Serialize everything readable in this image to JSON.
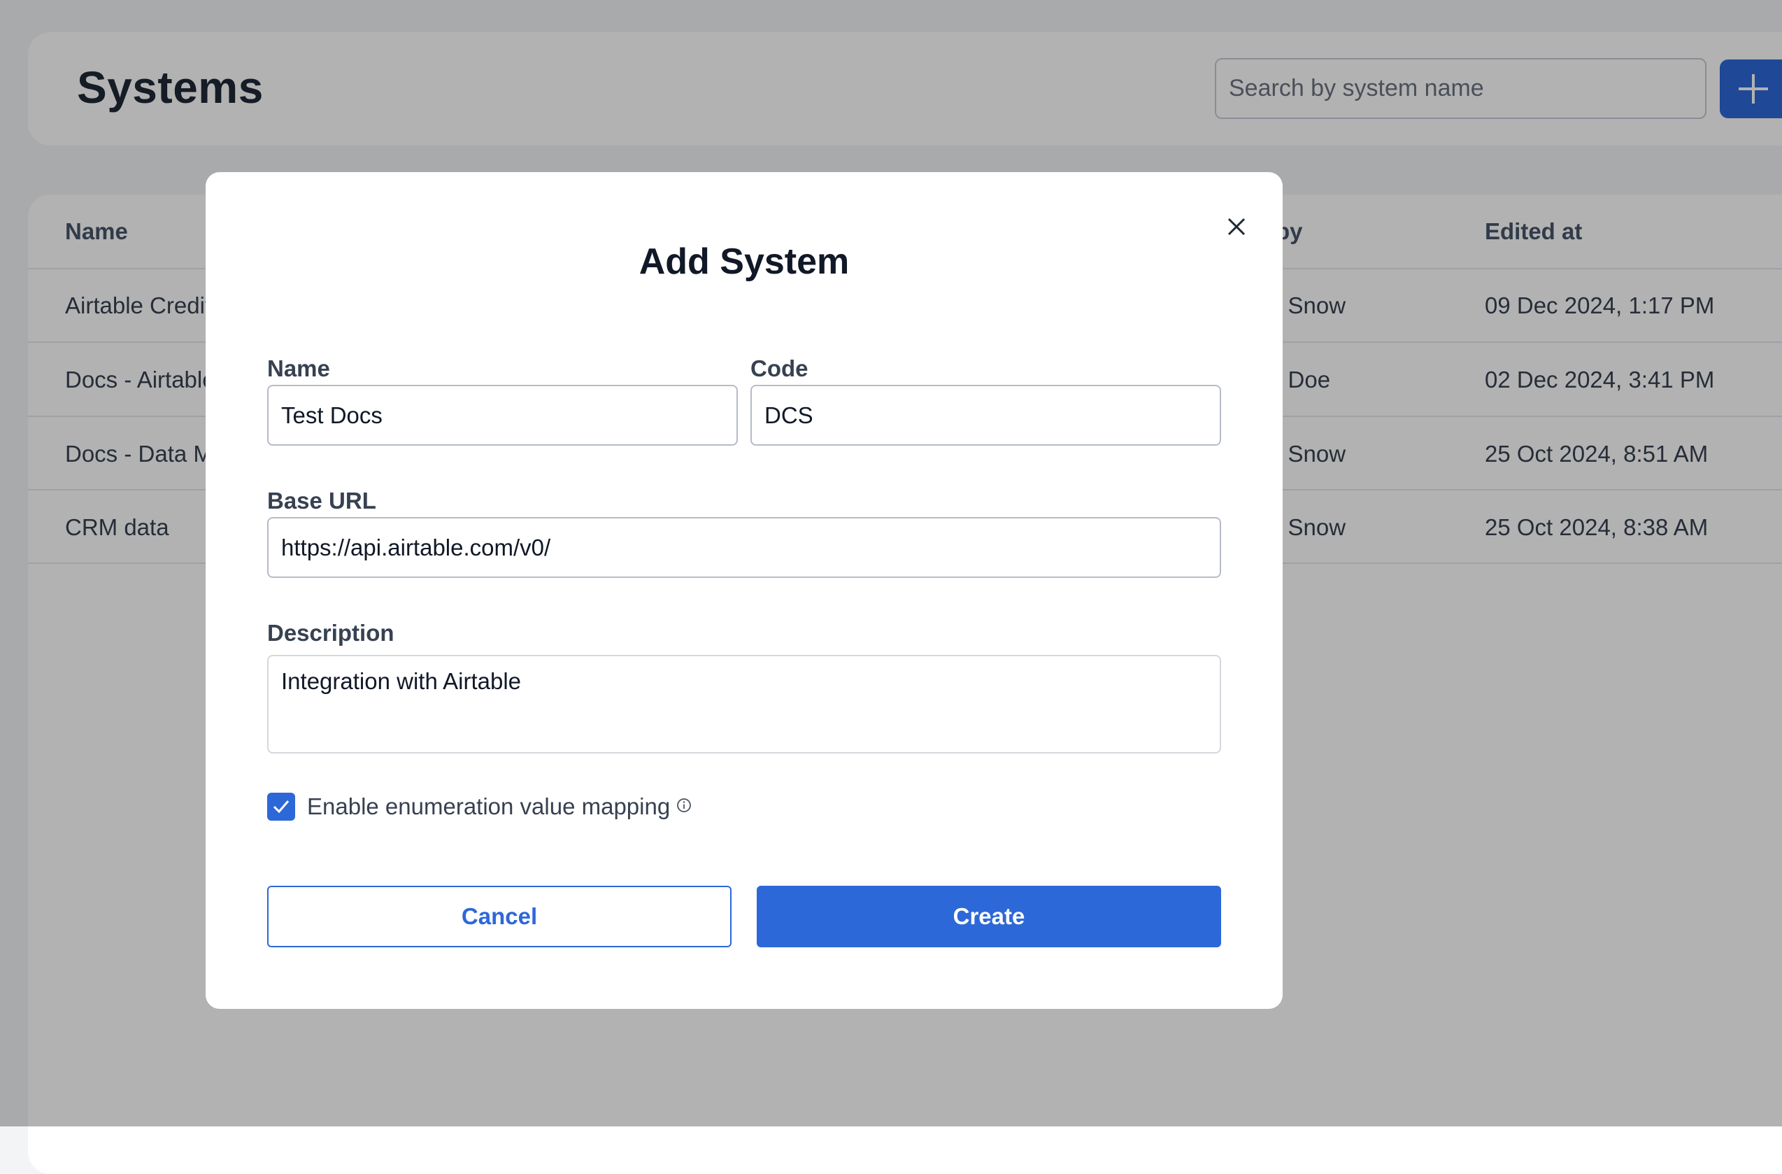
{
  "header": {
    "title": "Systems",
    "search_placeholder": "Search by system name",
    "add_icon": "plus-icon"
  },
  "table": {
    "columns": [
      "Name",
      "by",
      "Edited at"
    ],
    "rows": [
      {
        "name": "Airtable Credit",
        "by": "n Snow",
        "edited_at": "09 Dec 2024, 1:17 PM"
      },
      {
        "name": "Docs - Airtable",
        "by": "n Doe",
        "edited_at": "02 Dec 2024, 3:41 PM"
      },
      {
        "name": "Docs - Data M",
        "by": "n Snow",
        "edited_at": "25 Oct 2024, 8:51 AM"
      },
      {
        "name": "CRM data",
        "by": "n Snow",
        "edited_at": "25 Oct 2024, 8:38 AM"
      }
    ]
  },
  "modal": {
    "title": "Add System",
    "close_icon": "close-icon",
    "name_label": "Name",
    "name_value": "Test Docs",
    "code_label": "Code",
    "code_value": "DCS",
    "base_url_label": "Base URL",
    "base_url_value": "https://api.airtable.com/v0/",
    "description_label": "Description",
    "description_value": "Integration with Airtable",
    "enum_mapping_label": "Enable enumeration value mapping",
    "enum_mapping_checked": true,
    "info_icon": "info-icon",
    "cancel_label": "Cancel",
    "create_label": "Create"
  },
  "colors": {
    "accent": "#2d68d8",
    "overlay": "rgba(0,0,0,0.30)"
  }
}
